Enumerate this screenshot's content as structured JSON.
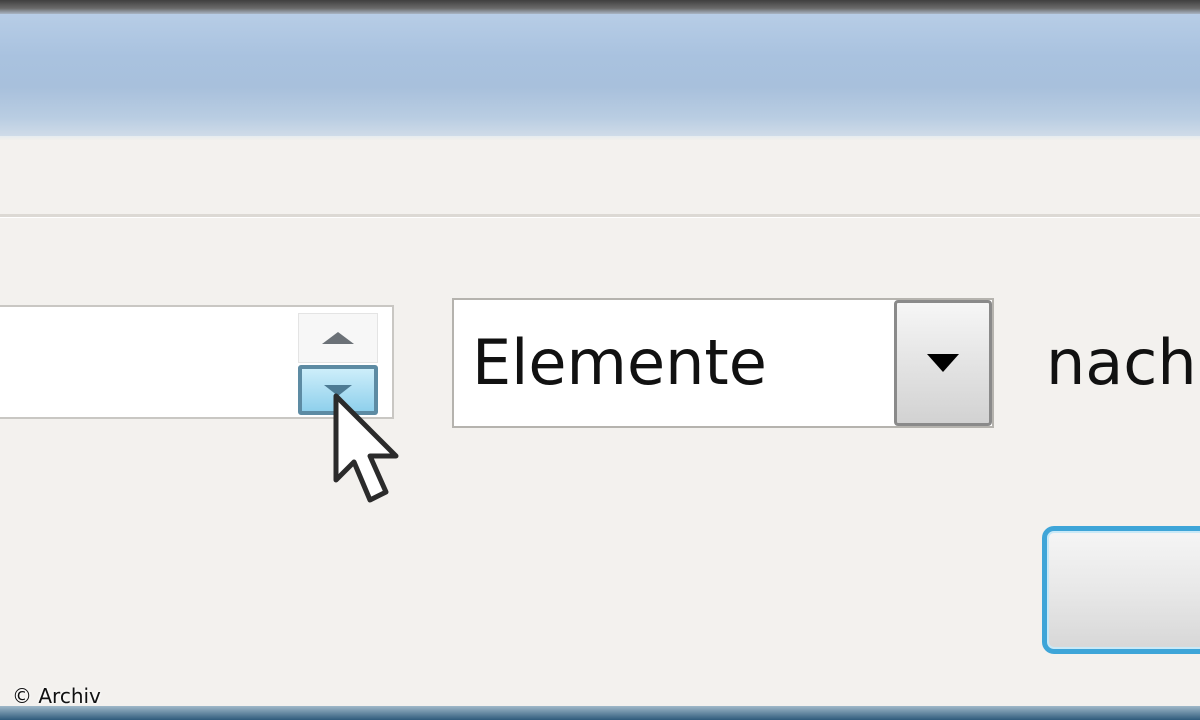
{
  "spinbox": {
    "value": ""
  },
  "combobox": {
    "selected": "Elemente"
  },
  "labels": {
    "nach": "nach"
  },
  "button": {
    "label": ""
  },
  "footer": {
    "copyright": "© Archiv"
  },
  "icons": {
    "spin_up": "chevron-up-icon",
    "spin_down": "chevron-down-icon",
    "combo_dropdown": "chevron-down-icon",
    "cursor": "mouse-pointer-icon"
  },
  "colors": {
    "titlebar": "#a9c2df",
    "dialog_background": "#f3f1ee",
    "focus_accent": "#3ea5d8",
    "hover_spin": "#8fd0ec"
  }
}
